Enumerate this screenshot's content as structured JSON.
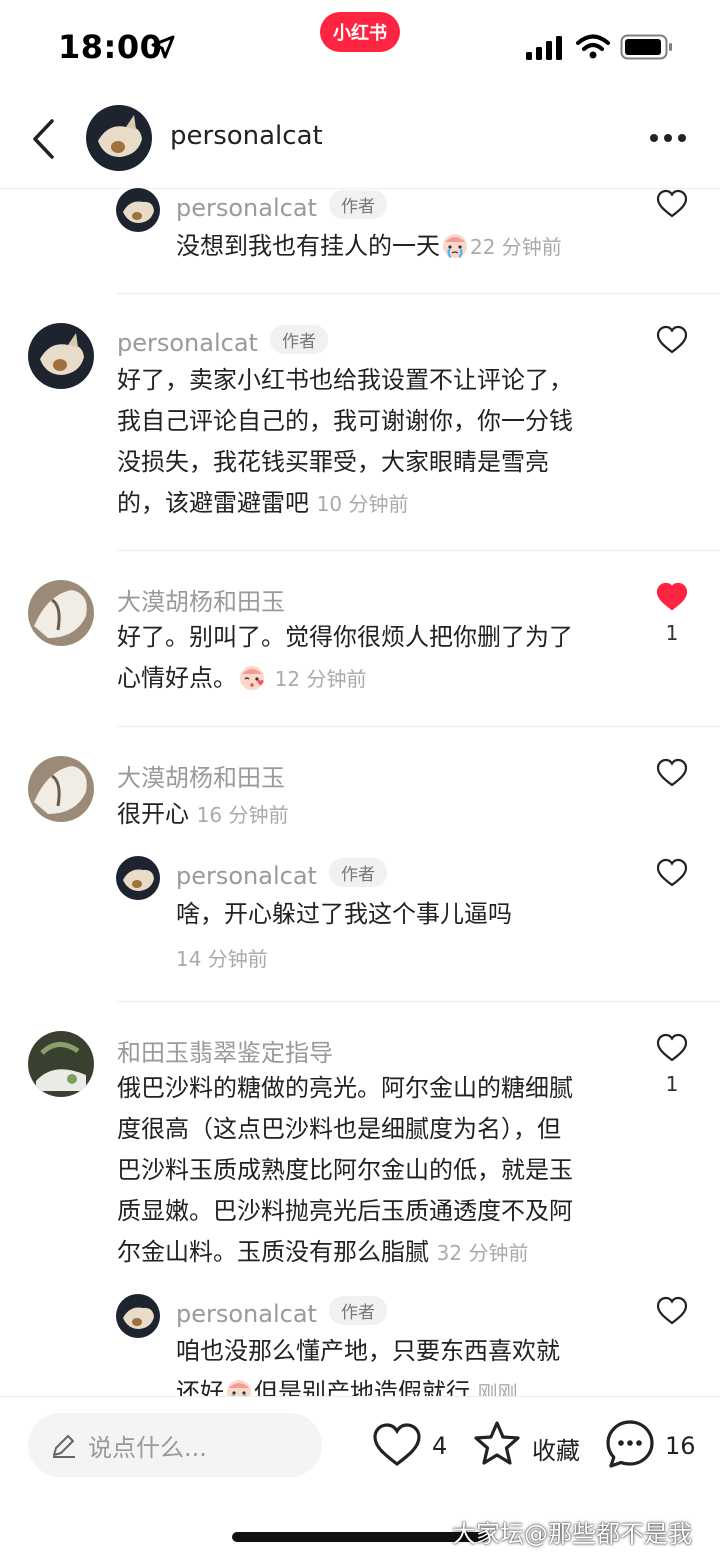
{
  "status_bar": {
    "time": "18:00",
    "app_badge": "小红书"
  },
  "header": {
    "username": "personalcat"
  },
  "author_tag": "作者",
  "comments": [
    {
      "name": "personalcat",
      "text": "没想到我也有挂人的一天",
      "time": "22 分钟前",
      "emoji": "crying-face",
      "author": true
    },
    {
      "name": "personalcat",
      "lines": [
        "好了，卖家小红书也给我设置不让评论了，",
        "我自己评论自己的，我可谢谢你，你一分钱",
        "没损失，我花钱买罪受，大家眼睛是雪亮",
        "的，该避雷避雷吧"
      ],
      "time": "10 分钟前",
      "author": true
    },
    {
      "name": "大漠胡杨和田玉",
      "lines": [
        "好了。别叫了。觉得你很烦人把你删了为了",
        "心情好点。"
      ],
      "time": "12 分钟前",
      "emoji": "kissing-face",
      "likes": "1",
      "liked": true
    },
    {
      "name": "大漠胡杨和田玉",
      "text": "很开心",
      "time": "16 分钟前"
    },
    {
      "name": "personalcat",
      "text": "啥，开心躲过了我这个事儿逼吗",
      "time": "14 分钟前",
      "author": true
    },
    {
      "name": "和田玉翡翠鉴定指导",
      "lines": [
        "俄巴沙料的糖做的亮光。阿尔金山的糖细腻",
        "度很高（这点巴沙料也是细腻度为名），但",
        "巴沙料玉质成熟度比阿尔金山的低，就是玉",
        "质显嫩。巴沙料抛亮光后玉质通透度不及阿",
        "尔金山料。玉质没有那么脂腻"
      ],
      "time": "32 分钟前",
      "likes": "1"
    },
    {
      "name": "personalcat",
      "lines": [
        "咱也没那么懂产地，只要东西喜欢就",
        "还好"
      ],
      "line2_rest": "但是别产地造假就行",
      "time": "刚刚",
      "emoji": "crying-face",
      "author": true
    }
  ],
  "bottom_bar": {
    "input_placeholder": "说点什么...",
    "like_count": "4",
    "collect_label": "收藏",
    "comment_count": "16"
  },
  "watermark": "大家坛@那些都不是我",
  "colors": {
    "accent": "#ff2442",
    "like_active": "#ff2442",
    "muted": "#9a9a9a"
  }
}
